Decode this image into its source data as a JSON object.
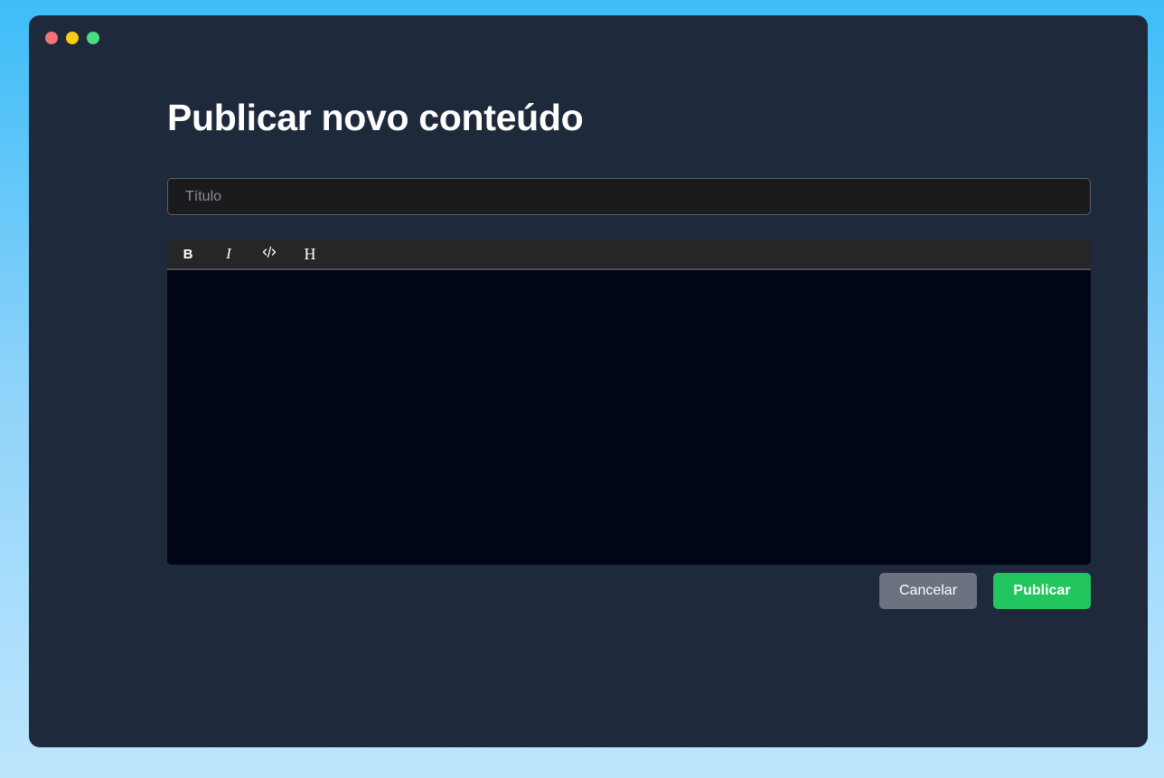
{
  "window": {
    "traffic_lights": [
      {
        "name": "close",
        "color": "#f47272"
      },
      {
        "name": "minimize",
        "color": "#facc15"
      },
      {
        "name": "zoom",
        "color": "#4ade80"
      }
    ]
  },
  "page": {
    "title": "Publicar novo conteúdo"
  },
  "form": {
    "title_placeholder": "Título",
    "title_value": ""
  },
  "toolbar": {
    "bold_label": "B",
    "italic_label": "I",
    "code_icon": "code-icon",
    "heading_label": "H"
  },
  "actions": {
    "cancel_label": "Cancelar",
    "publish_label": "Publicar"
  },
  "colors": {
    "window_bg": "#1f293c",
    "editor_bg": "#010616",
    "cancel_bg": "#6b7280",
    "publish_bg": "#22c55e"
  }
}
